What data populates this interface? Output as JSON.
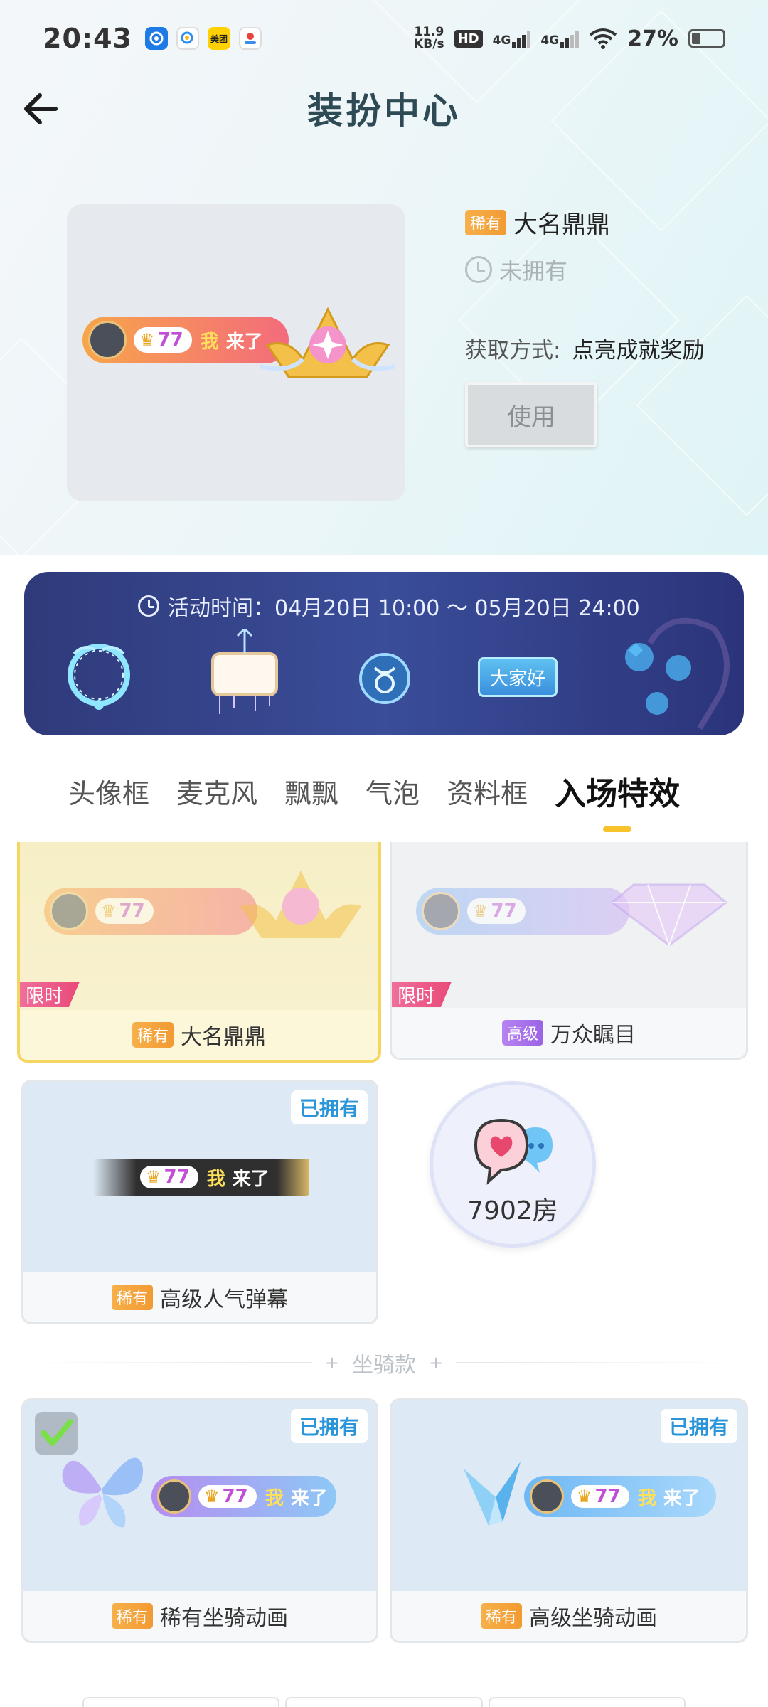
{
  "status_bar": {
    "time": "20:43",
    "app_icons": [
      "fitness-ring-icon",
      "search-app-icon",
      "meituan-icon",
      "pinduoduo-icon"
    ],
    "meituan_label": "美团",
    "net_speed_value": "11.9",
    "net_speed_unit": "KB/s",
    "hd_label": "HD",
    "signal1_label": "4G",
    "signal2_label": "4G",
    "battery_percent": "27%",
    "battery_level": 0.27
  },
  "header": {
    "title": "装扮中心",
    "back_icon": "back-arrow-icon"
  },
  "preview": {
    "level": "77",
    "entry_prefix": "我",
    "entry_text": "来了"
  },
  "item_info": {
    "rarity": "稀有",
    "name": "大名鼎鼎",
    "status": "未拥有",
    "acquire_label": "获取方式:",
    "acquire_value": "点亮成就奖励",
    "use_button": "使用"
  },
  "banner": {
    "time_text": "活动时间：04月20日 10:00 ～ 05月20日 24:00",
    "hello_text": "大家好"
  },
  "tabs": [
    {
      "label": "头像框",
      "active": false
    },
    {
      "label": "麦克风",
      "active": false
    },
    {
      "label": "飘飘",
      "active": false
    },
    {
      "label": "气泡",
      "active": false
    },
    {
      "label": "资料框",
      "active": false
    },
    {
      "label": "入场特效",
      "active": true
    }
  ],
  "cards": [
    {
      "rarity": "稀有",
      "name": "大名鼎鼎",
      "limited": "限时"
    },
    {
      "rarity": "高级",
      "name": "万众瞩目",
      "limited": "限时"
    },
    {
      "rarity": "稀有",
      "name": "高级人气弹幕",
      "owned": "已拥有"
    }
  ],
  "room_button": {
    "label": "7902房"
  },
  "separator": {
    "label": "坐骑款"
  },
  "mount_cards": [
    {
      "rarity": "稀有",
      "name": "稀有坐骑动画",
      "owned": "已拥有",
      "selected": true
    },
    {
      "rarity": "稀有",
      "name": "高级坐骑动画",
      "owned": "已拥有"
    }
  ],
  "colors": {
    "accent_yellow": "#f8c32a",
    "title_color": "#2e4a55",
    "owned_blue": "#2a95d8",
    "rare_orange": "#f29a33",
    "advanced_purple": "#9a63e6",
    "limited_pink": "#e94a78",
    "banner_blue": "#3a4d99"
  }
}
